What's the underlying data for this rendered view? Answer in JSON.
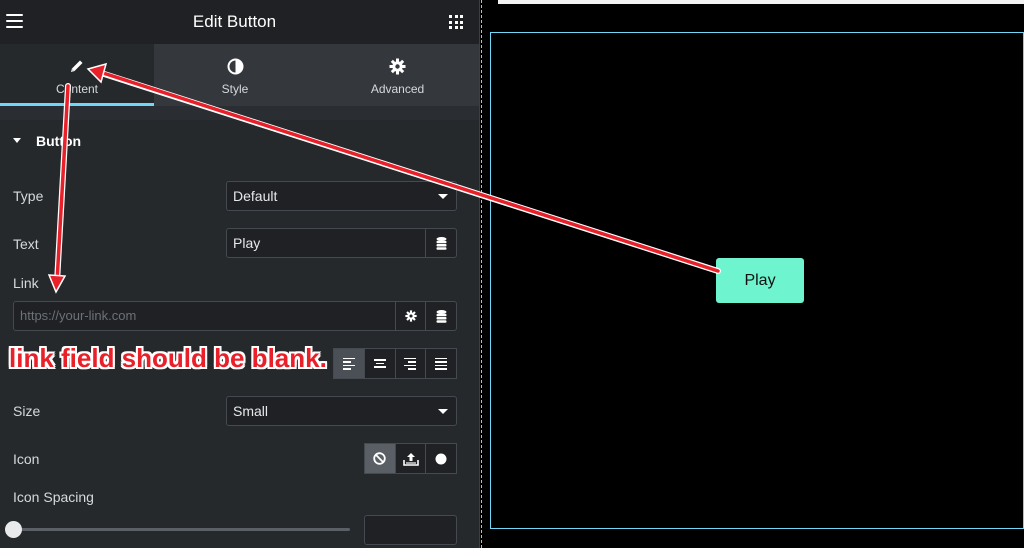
{
  "header": {
    "title": "Edit Button"
  },
  "tabs": [
    {
      "label": "Content",
      "icon": "pencil-icon",
      "active": true
    },
    {
      "label": "Style",
      "icon": "contrast-icon",
      "active": false
    },
    {
      "label": "Advanced",
      "icon": "gear-icon",
      "active": false
    }
  ],
  "section": {
    "title": "Button"
  },
  "fields": {
    "type": {
      "label": "Type",
      "value": "Default"
    },
    "text": {
      "label": "Text",
      "value": "Play"
    },
    "link": {
      "label": "Link",
      "placeholder": "https://your-link.com"
    },
    "size": {
      "label": "Size",
      "value": "Small"
    },
    "icon": {
      "label": "Icon",
      "options": [
        "none",
        "upload",
        "circle"
      ],
      "selected": "none"
    },
    "icon_spacing": {
      "label": "Icon Spacing",
      "value": ""
    }
  },
  "alignment": {
    "options": [
      "left",
      "center",
      "right",
      "justify"
    ],
    "selected": "left"
  },
  "canvas": {
    "button_label": "Play",
    "button_color": "#6ef4cf"
  },
  "annotation": {
    "text": "link field should be blank.",
    "color": "#e8202a"
  },
  "colors": {
    "accent": "#71d7f7",
    "panel": "#26292c"
  }
}
